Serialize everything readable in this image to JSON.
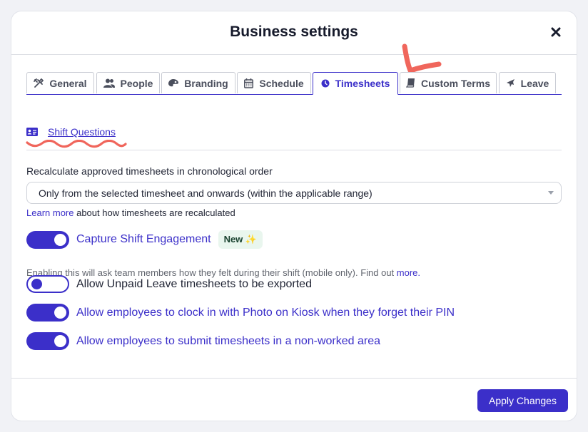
{
  "modal": {
    "title": "Business settings",
    "close_icon": "close-icon"
  },
  "tabs": [
    {
      "label": "General",
      "icon": "tools-icon"
    },
    {
      "label": "People",
      "icon": "people-icon"
    },
    {
      "label": "Branding",
      "icon": "palette-icon"
    },
    {
      "label": "Schedule",
      "icon": "calendar-icon"
    },
    {
      "label": "Timesheets",
      "icon": "clock-icon",
      "active": true
    },
    {
      "label": "Custom Terms",
      "icon": "book-icon"
    },
    {
      "label": "Leave",
      "icon": "plane-icon"
    }
  ],
  "section": {
    "link_label": "Shift Questions",
    "icon": "id-card-icon"
  },
  "recalc": {
    "label": "Recalculate approved timesheets in chronological order",
    "selected": "Only from the selected timesheet and onwards (within the applicable range)",
    "learn_link": "Learn more",
    "learn_rest": " about how timesheets are recalculated"
  },
  "toggles": {
    "capture": {
      "label": "Capture Shift Engagement",
      "on": true,
      "badge": "New ✨"
    },
    "capture_help": "Enabling this will ask team members how they felt during their shift (mobile only). Find out ",
    "capture_help_link": "more.",
    "unpaid": {
      "label": "Allow Unpaid Leave timesheets to be exported",
      "on": false
    },
    "photo": {
      "label": "Allow employees to clock in with Photo on Kiosk when they forget their PIN",
      "on": true
    },
    "nonworked": {
      "label": "Allow employees to submit timesheets in a non-worked area",
      "on": true
    }
  },
  "footer": {
    "apply_label": "Apply Changes"
  },
  "colors": {
    "accent": "#3b2fc9",
    "annotation": "#f0665c",
    "badge_bg": "#e9f6ee"
  }
}
